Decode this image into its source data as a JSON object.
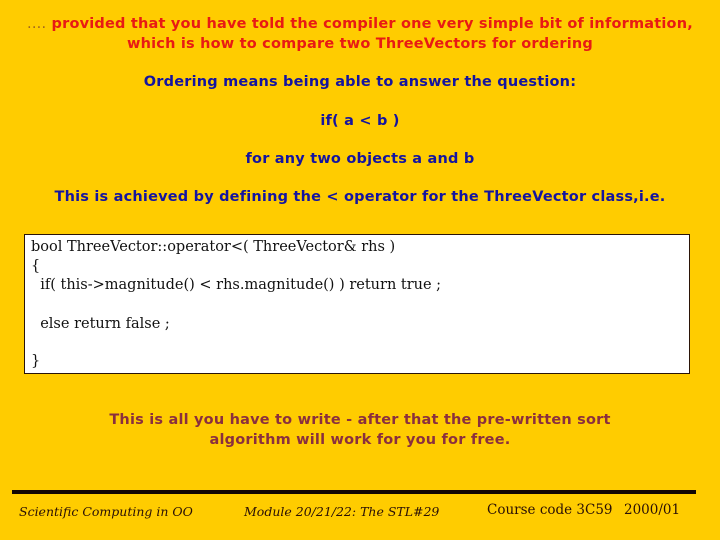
{
  "slide": {
    "intro": {
      "leading_dots": "....",
      "line1": " provided that you have told the compiler one very simple bit of information,",
      "line2": "which is how to compare two ThreeVectors for ordering"
    },
    "ordering_statement": "Ordering means being able to answer the question:",
    "question": "if( a < b )",
    "objects_statement": "for any two objects a and b",
    "achieved_statement": "This is achieved by defining the < operator for the ThreeVector class,i.e.",
    "code": {
      "lines": [
        "bool ThreeVector::operator<( ThreeVector& rhs )",
        "{",
        "  if( this->magnitude() < rhs.magnitude() ) return true ;",
        "  else return false ;",
        "}"
      ]
    },
    "conclusion": {
      "line1": "This is all you have to write - after that the pre-written sort",
      "line2": "algorithm will work for you for free."
    },
    "colors": {
      "background": "#FFCC00",
      "intro_text": "#E81A14",
      "body_text": "#1414A0",
      "conclusion_text": "#8A2F3E"
    }
  },
  "footer": {
    "course_title": "Scientific Computing in OO",
    "module": "Module 20/21/22: The STL",
    "slide_number": "#29",
    "course_code": "Course code 3C59",
    "year": "2000/01"
  }
}
